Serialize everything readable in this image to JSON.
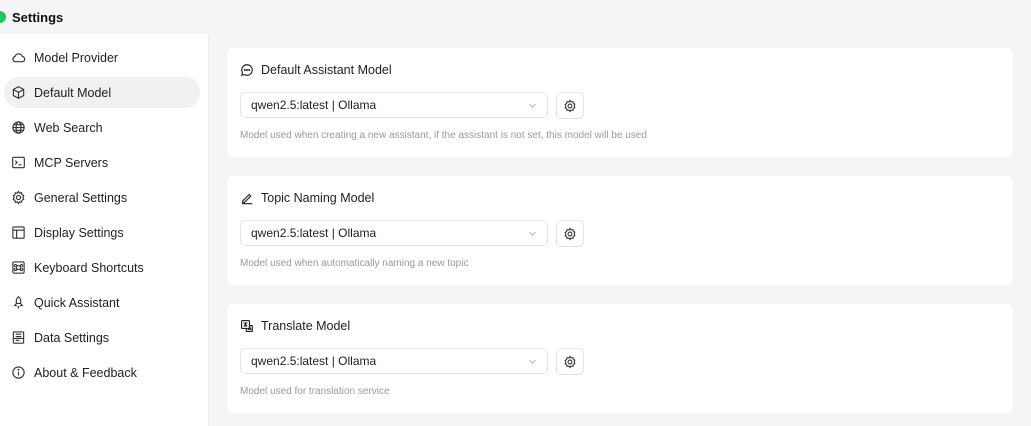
{
  "window": {
    "title": "Settings",
    "status_color": "#22c55e"
  },
  "sidebar": {
    "items": [
      {
        "label": "Model Provider",
        "icon": "cloud-icon",
        "active": false
      },
      {
        "label": "Default Model",
        "icon": "cube-icon",
        "active": true
      },
      {
        "label": "Web Search",
        "icon": "globe-icon",
        "active": false
      },
      {
        "label": "MCP Servers",
        "icon": "terminal-icon",
        "active": false
      },
      {
        "label": "General Settings",
        "icon": "gear-icon",
        "active": false
      },
      {
        "label": "Display Settings",
        "icon": "layout-icon",
        "active": false
      },
      {
        "label": "Keyboard Shortcuts",
        "icon": "command-icon",
        "active": false
      },
      {
        "label": "Quick Assistant",
        "icon": "rocket-icon",
        "active": false
      },
      {
        "label": "Data Settings",
        "icon": "database-icon",
        "active": false
      },
      {
        "label": "About & Feedback",
        "icon": "info-icon",
        "active": false
      }
    ]
  },
  "cards": [
    {
      "title": "Default Assistant Model",
      "icon": "chat-bubble-icon",
      "selected": "qwen2.5:latest | Ollama",
      "hint": "Model used when creating a new assistant, if the assistant is not set, this model will be used"
    },
    {
      "title": "Topic Naming Model",
      "icon": "pencil-icon",
      "selected": "qwen2.5:latest | Ollama",
      "hint": "Model used when automatically naming a new topic"
    },
    {
      "title": "Translate Model",
      "icon": "translate-icon",
      "selected": "qwen2.5:latest | Ollama",
      "hint": "Model used for translation service"
    }
  ]
}
